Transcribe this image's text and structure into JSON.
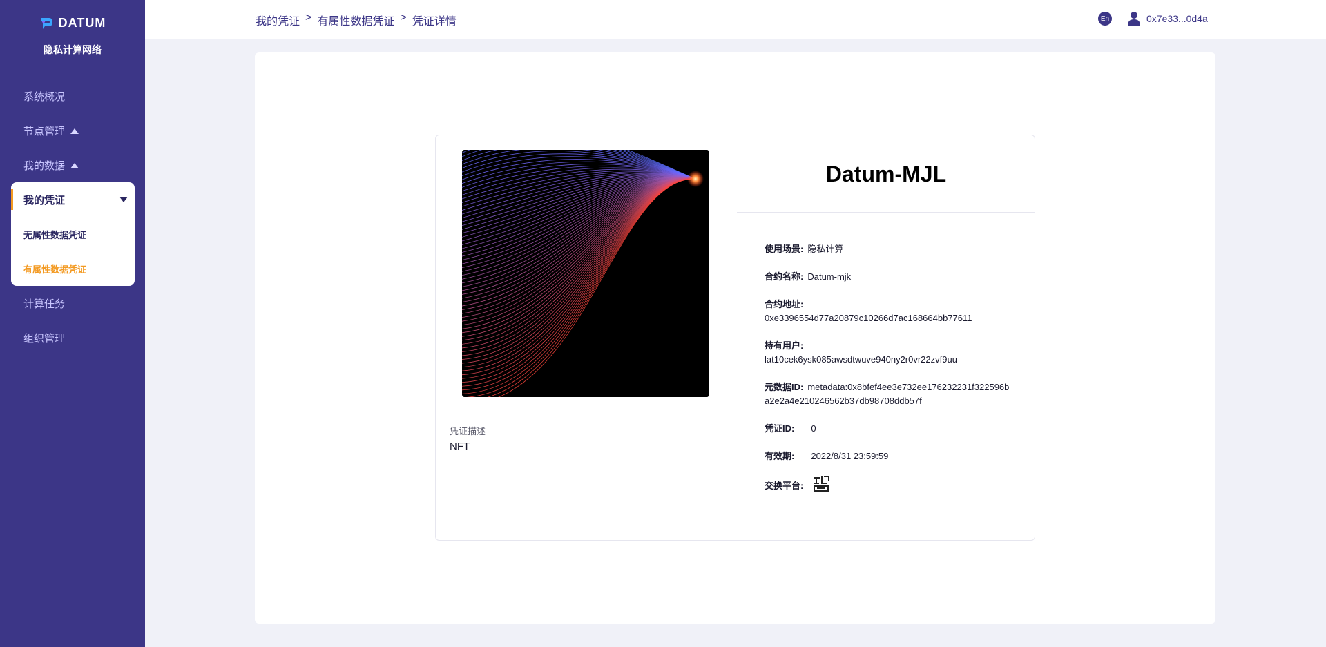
{
  "sidebar": {
    "logo_text": "DATUM",
    "subtitle": "隐私计算网络",
    "items": [
      {
        "label": "系统概况"
      },
      {
        "label": "节点管理"
      },
      {
        "label": "我的数据"
      },
      {
        "label": "我的凭证"
      },
      {
        "label": "计算任务"
      },
      {
        "label": "组织管理"
      }
    ],
    "submenu": [
      {
        "label": "无属性数据凭证"
      },
      {
        "label": "有属性数据凭证"
      }
    ]
  },
  "header": {
    "breadcrumb": [
      "我的凭证",
      ">",
      "有属性数据凭证",
      ">",
      "凭证详情"
    ],
    "lang": "En",
    "address": "0x7e33...0d4a"
  },
  "card": {
    "title": "Datum-MJL",
    "description_label": "凭证描述",
    "description_value": "NFT",
    "fields": {
      "scene_label": "使用场景:",
      "scene_value": "隐私计算",
      "contract_name_label": "合约名称:",
      "contract_name_value": "Datum-mjk",
      "contract_address_label": "合约地址:",
      "contract_address_value": "0xe3396554d77a20879c10266d7ac168664bb77611",
      "holder_label": "持有用户:",
      "holder_value": "lat10cek6ysk085awsdtwuve940ny2r0vr22zvf9uu",
      "metadata_label": "元数据ID:",
      "metadata_value": "metadata:0x8bfef4ee3e732ee176232231f322596ba2e2a4e210246562b37db98708ddb57f",
      "credential_id_label": "凭证ID:",
      "credential_id_value": "0",
      "validity_label": "有效期:",
      "validity_value": "2022/8/31 23:59:59",
      "platform_label": "交换平台:"
    }
  },
  "colors": {
    "sidebar_bg": "#3c3687",
    "accent_orange": "#f39a22",
    "page_bg": "#f0f1f8"
  }
}
